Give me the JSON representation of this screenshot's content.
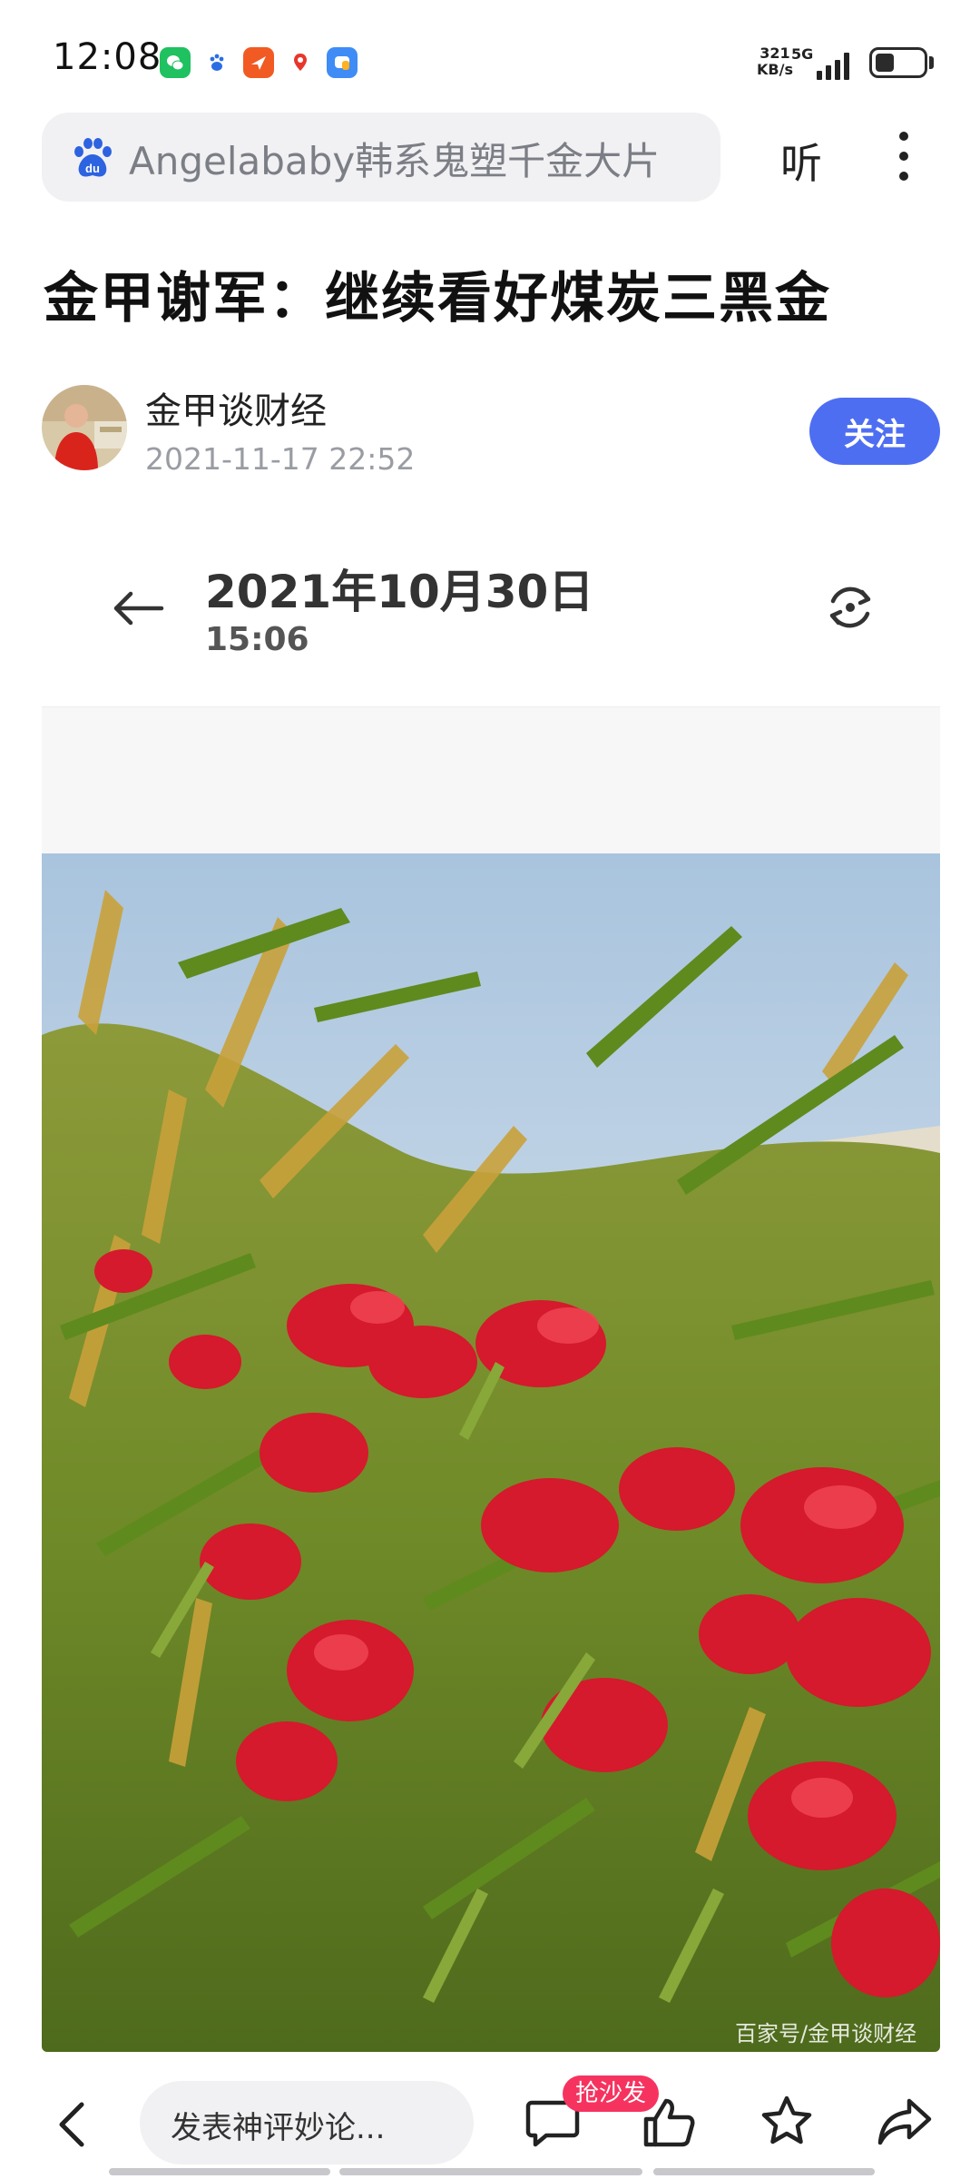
{
  "status_bar": {
    "time": "12:08",
    "net_speed_value": "321",
    "net_speed_unit": "KB/s",
    "network": "5G",
    "app_icons": [
      "wechat-icon",
      "baidu-icon",
      "feishu-icon",
      "map-icon",
      "messenger-icon"
    ]
  },
  "search": {
    "query": "Angelababy韩系鬼塑千金大片",
    "listen_label": "听"
  },
  "article": {
    "title": "金甲谢军：继续看好煤炭三黑金",
    "author": "金甲谈财经",
    "publish_time": "2021-11-17 22:52",
    "follow_label": "关注"
  },
  "post": {
    "date": "2021年10月30日",
    "time": "15:06",
    "watermark": "百家号/金甲谈财经"
  },
  "bottom_bar": {
    "comment_placeholder": "发表神评妙论...",
    "sofa_badge": "抢沙发"
  },
  "colors": {
    "accent": "#4e6ef2",
    "badge": "#f6335f",
    "muted_text": "#9a9ca3"
  }
}
